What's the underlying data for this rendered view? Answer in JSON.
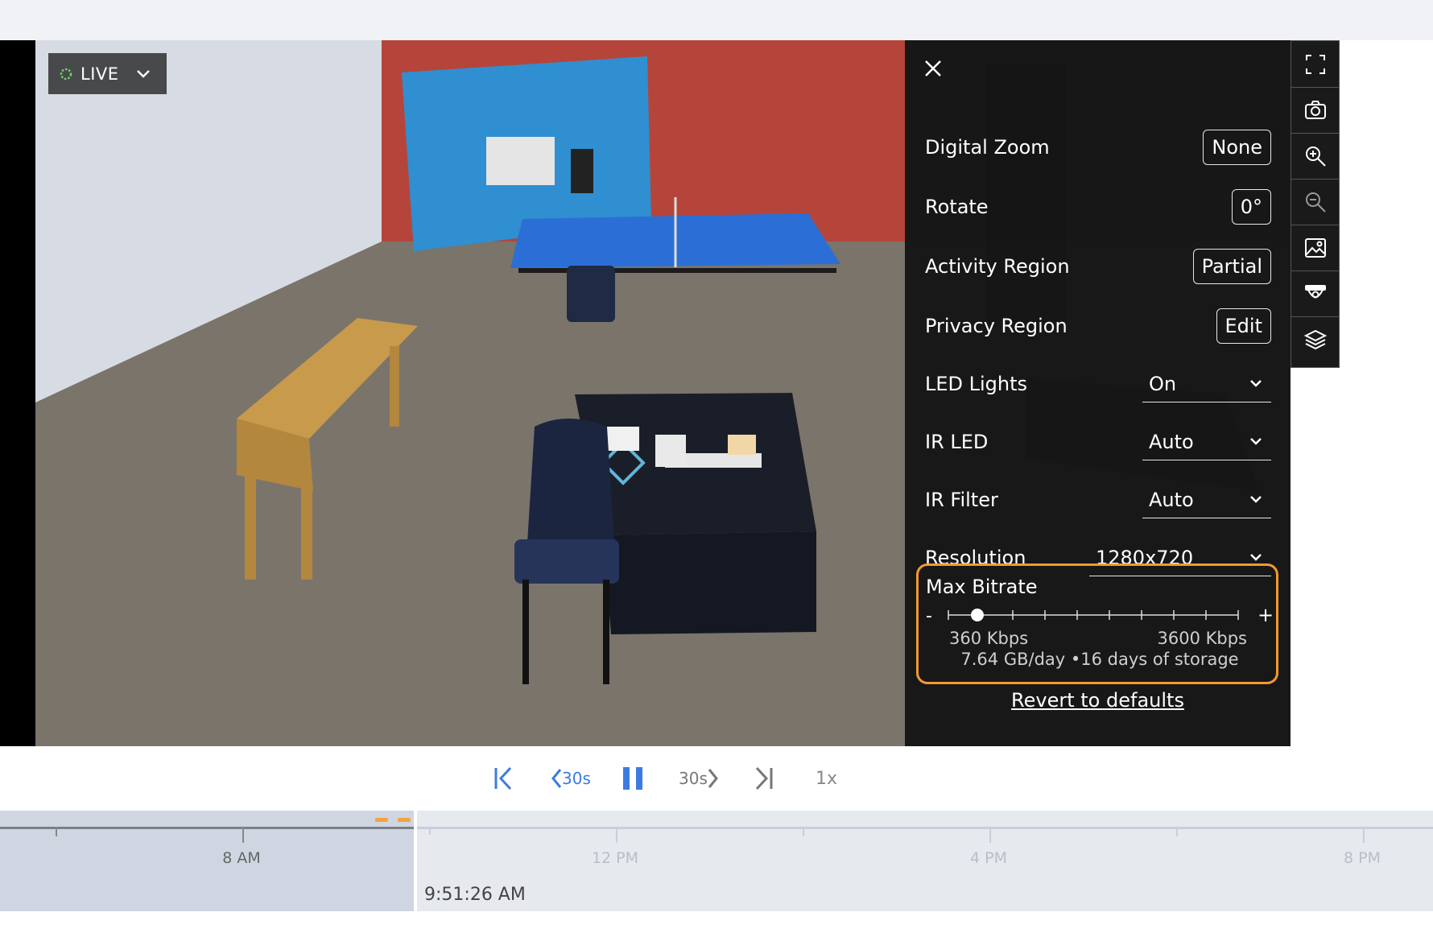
{
  "live_badge": {
    "label": "LIVE"
  },
  "settings": {
    "rows": [
      {
        "label": "Digital Zoom",
        "value": "None"
      },
      {
        "label": "Rotate",
        "value": "0°"
      },
      {
        "label": "Activity Region",
        "value": "Partial"
      },
      {
        "label": "Privacy Region",
        "value": "Edit"
      },
      {
        "label": "LED Lights",
        "value": "On"
      },
      {
        "label": "IR LED",
        "value": "Auto"
      },
      {
        "label": "IR Filter",
        "value": "Auto"
      },
      {
        "label": "Resolution",
        "value": "1280x720"
      }
    ],
    "bitrate": {
      "title": "Max Bitrate",
      "minus": "-",
      "plus": "+",
      "min_label": "360 Kbps",
      "max_label": "3600 Kbps",
      "level": 0.1,
      "storage": "7.64 GB/day •16 days of storage"
    },
    "revert": "Revert to defaults"
  },
  "toolbar": {
    "icons": [
      "fullscreen-icon",
      "camera-icon",
      "zoom-in-icon",
      "zoom-out-icon",
      "image-icon",
      "dome-camera-icon",
      "layers-icon"
    ]
  },
  "controls": {
    "back_30": "30s",
    "fwd_30": "30s",
    "speed": "1x"
  },
  "timeline": {
    "labels": [
      "8 AM",
      "12 PM",
      "4 PM",
      "8 PM"
    ],
    "current_time": "9:51:26 AM"
  },
  "colors": {
    "accent_blue": "#3d7be0",
    "highlight_orange": "#f39a2c",
    "live_green": "#6fd36f"
  }
}
